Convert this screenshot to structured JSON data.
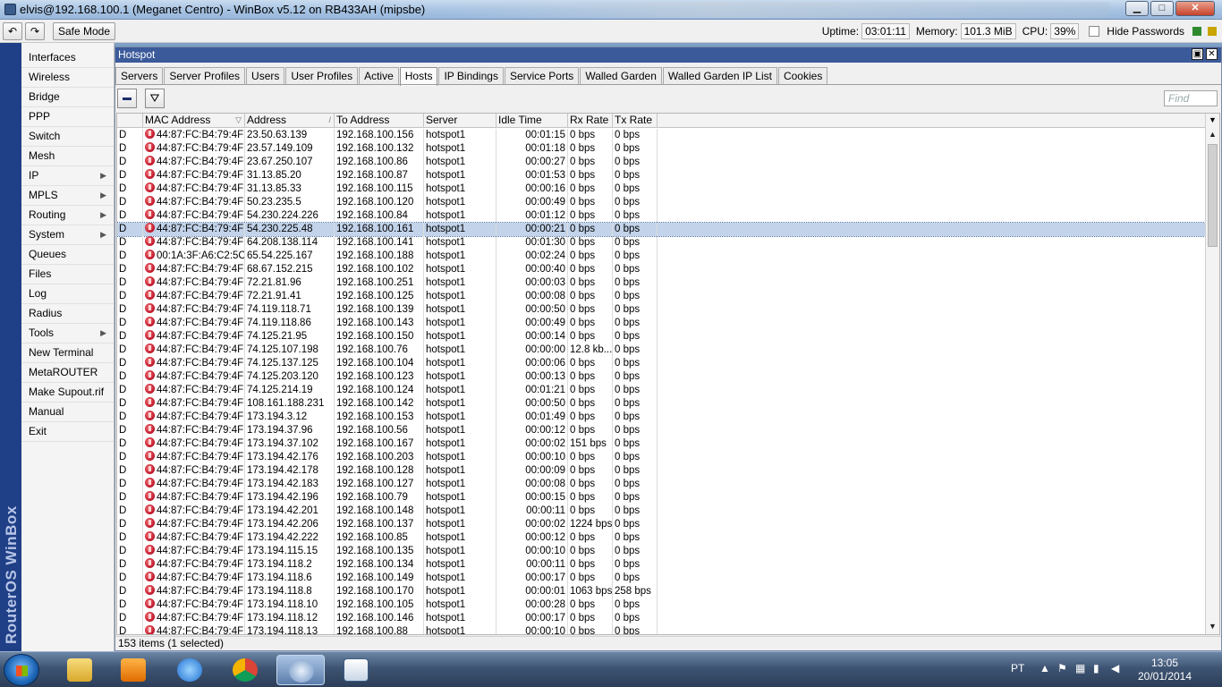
{
  "window": {
    "title": "elvis@192.168.100.1 (Meganet Centro) - WinBox v5.12 on RB433AH (mipsbe)",
    "buttons": {
      "minimize": "▁",
      "maximize": "□",
      "close": "✕"
    }
  },
  "toolbar": {
    "undo": "↶",
    "redo": "↷",
    "safe_mode": "Safe Mode",
    "uptime_label": "Uptime:",
    "uptime": "03:01:11",
    "memory_label": "Memory:",
    "memory": "101.3 MiB",
    "cpu_label": "CPU:",
    "cpu": "39%",
    "hide_passwords": "Hide Passwords"
  },
  "brand": "RouterOS WinBox",
  "menu": [
    {
      "label": "Interfaces",
      "arrow": ""
    },
    {
      "label": "Wireless",
      "arrow": ""
    },
    {
      "label": "Bridge",
      "arrow": ""
    },
    {
      "label": "PPP",
      "arrow": ""
    },
    {
      "label": "Switch",
      "arrow": ""
    },
    {
      "label": "Mesh",
      "arrow": ""
    },
    {
      "label": "IP",
      "arrow": "▶"
    },
    {
      "label": "MPLS",
      "arrow": "▶"
    },
    {
      "label": "Routing",
      "arrow": "▶"
    },
    {
      "label": "System",
      "arrow": "▶"
    },
    {
      "label": "Queues",
      "arrow": ""
    },
    {
      "label": "Files",
      "arrow": ""
    },
    {
      "label": "Log",
      "arrow": ""
    },
    {
      "label": "Radius",
      "arrow": ""
    },
    {
      "label": "Tools",
      "arrow": "▶"
    },
    {
      "label": "New Terminal",
      "arrow": ""
    },
    {
      "label": "MetaROUTER",
      "arrow": ""
    },
    {
      "label": "Make Supout.rif",
      "arrow": ""
    },
    {
      "label": "Manual",
      "arrow": ""
    },
    {
      "label": "Exit",
      "arrow": ""
    }
  ],
  "hotspot": {
    "title": "Hotspot",
    "tabs": [
      "Servers",
      "Server Profiles",
      "Users",
      "User Profiles",
      "Active",
      "Hosts",
      "IP Bindings",
      "Service Ports",
      "Walled Garden",
      "Walled Garden IP List",
      "Cookies"
    ],
    "active_tab": "Hosts",
    "filter_icon": "⛛",
    "find_placeholder": "Find",
    "columns": [
      {
        "label": "MAC Address",
        "sort": "▽"
      },
      {
        "label": "Address",
        "sort": "/"
      },
      {
        "label": "To Address",
        "sort": ""
      },
      {
        "label": "Server",
        "sort": ""
      },
      {
        "label": "Idle Time",
        "sort": ""
      },
      {
        "label": "Rx Rate",
        "sort": ""
      },
      {
        "label": "Tx Rate",
        "sort": ""
      }
    ],
    "scroll": {
      "col_menu": "▼",
      "up": "▲",
      "down": "▼"
    },
    "rows": [
      {
        "flag": "D",
        "mac": "44:87:FC:B4:79:4F",
        "address": "23.50.63.139",
        "to": "192.168.100.156",
        "server": "hotspot1",
        "idle": "00:01:15",
        "rx": "0 bps",
        "tx": "0 bps"
      },
      {
        "flag": "D",
        "mac": "44:87:FC:B4:79:4F",
        "address": "23.57.149.109",
        "to": "192.168.100.132",
        "server": "hotspot1",
        "idle": "00:01:18",
        "rx": "0 bps",
        "tx": "0 bps"
      },
      {
        "flag": "D",
        "mac": "44:87:FC:B4:79:4F",
        "address": "23.67.250.107",
        "to": "192.168.100.86",
        "server": "hotspot1",
        "idle": "00:00:27",
        "rx": "0 bps",
        "tx": "0 bps"
      },
      {
        "flag": "D",
        "mac": "44:87:FC:B4:79:4F",
        "address": "31.13.85.20",
        "to": "192.168.100.87",
        "server": "hotspot1",
        "idle": "00:01:53",
        "rx": "0 bps",
        "tx": "0 bps"
      },
      {
        "flag": "D",
        "mac": "44:87:FC:B4:79:4F",
        "address": "31.13.85.33",
        "to": "192.168.100.115",
        "server": "hotspot1",
        "idle": "00:00:16",
        "rx": "0 bps",
        "tx": "0 bps"
      },
      {
        "flag": "D",
        "mac": "44:87:FC:B4:79:4F",
        "address": "50.23.235.5",
        "to": "192.168.100.120",
        "server": "hotspot1",
        "idle": "00:00:49",
        "rx": "0 bps",
        "tx": "0 bps"
      },
      {
        "flag": "D",
        "mac": "44:87:FC:B4:79:4F",
        "address": "54.230.224.226",
        "to": "192.168.100.84",
        "server": "hotspot1",
        "idle": "00:01:12",
        "rx": "0 bps",
        "tx": "0 bps"
      },
      {
        "flag": "D",
        "mac": "44:87:FC:B4:79:4F",
        "address": "54.230.225.48",
        "to": "192.168.100.161",
        "server": "hotspot1",
        "idle": "00:00:21",
        "rx": "0 bps",
        "tx": "0 bps",
        "selected": true
      },
      {
        "flag": "D",
        "mac": "44:87:FC:B4:79:4F",
        "address": "64.208.138.114",
        "to": "192.168.100.141",
        "server": "hotspot1",
        "idle": "00:01:30",
        "rx": "0 bps",
        "tx": "0 bps"
      },
      {
        "flag": "D",
        "mac": "00:1A:3F:A6:C2:5C",
        "address": "65.54.225.167",
        "to": "192.168.100.188",
        "server": "hotspot1",
        "idle": "00:02:24",
        "rx": "0 bps",
        "tx": "0 bps"
      },
      {
        "flag": "D",
        "mac": "44:87:FC:B4:79:4F",
        "address": "68.67.152.215",
        "to": "192.168.100.102",
        "server": "hotspot1",
        "idle": "00:00:40",
        "rx": "0 bps",
        "tx": "0 bps"
      },
      {
        "flag": "D",
        "mac": "44:87:FC:B4:79:4F",
        "address": "72.21.81.96",
        "to": "192.168.100.251",
        "server": "hotspot1",
        "idle": "00:00:03",
        "rx": "0 bps",
        "tx": "0 bps"
      },
      {
        "flag": "D",
        "mac": "44:87:FC:B4:79:4F",
        "address": "72.21.91.41",
        "to": "192.168.100.125",
        "server": "hotspot1",
        "idle": "00:00:08",
        "rx": "0 bps",
        "tx": "0 bps"
      },
      {
        "flag": "D",
        "mac": "44:87:FC:B4:79:4F",
        "address": "74.119.118.71",
        "to": "192.168.100.139",
        "server": "hotspot1",
        "idle": "00:00:50",
        "rx": "0 bps",
        "tx": "0 bps"
      },
      {
        "flag": "D",
        "mac": "44:87:FC:B4:79:4F",
        "address": "74.119.118.86",
        "to": "192.168.100.143",
        "server": "hotspot1",
        "idle": "00:00:49",
        "rx": "0 bps",
        "tx": "0 bps"
      },
      {
        "flag": "D",
        "mac": "44:87:FC:B4:79:4F",
        "address": "74.125.21.95",
        "to": "192.168.100.150",
        "server": "hotspot1",
        "idle": "00:00:14",
        "rx": "0 bps",
        "tx": "0 bps"
      },
      {
        "flag": "D",
        "mac": "44:87:FC:B4:79:4F",
        "address": "74.125.107.198",
        "to": "192.168.100.76",
        "server": "hotspot1",
        "idle": "00:00:00",
        "rx": "12.8 kb...",
        "tx": "0 bps"
      },
      {
        "flag": "D",
        "mac": "44:87:FC:B4:79:4F",
        "address": "74.125.137.125",
        "to": "192.168.100.104",
        "server": "hotspot1",
        "idle": "00:00:06",
        "rx": "0 bps",
        "tx": "0 bps"
      },
      {
        "flag": "D",
        "mac": "44:87:FC:B4:79:4F",
        "address": "74.125.203.120",
        "to": "192.168.100.123",
        "server": "hotspot1",
        "idle": "00:00:13",
        "rx": "0 bps",
        "tx": "0 bps"
      },
      {
        "flag": "D",
        "mac": "44:87:FC:B4:79:4F",
        "address": "74.125.214.19",
        "to": "192.168.100.124",
        "server": "hotspot1",
        "idle": "00:01:21",
        "rx": "0 bps",
        "tx": "0 bps"
      },
      {
        "flag": "D",
        "mac": "44:87:FC:B4:79:4F",
        "address": "108.161.188.231",
        "to": "192.168.100.142",
        "server": "hotspot1",
        "idle": "00:00:50",
        "rx": "0 bps",
        "tx": "0 bps"
      },
      {
        "flag": "D",
        "mac": "44:87:FC:B4:79:4F",
        "address": "173.194.3.12",
        "to": "192.168.100.153",
        "server": "hotspot1",
        "idle": "00:01:49",
        "rx": "0 bps",
        "tx": "0 bps"
      },
      {
        "flag": "D",
        "mac": "44:87:FC:B4:79:4F",
        "address": "173.194.37.96",
        "to": "192.168.100.56",
        "server": "hotspot1",
        "idle": "00:00:12",
        "rx": "0 bps",
        "tx": "0 bps"
      },
      {
        "flag": "D",
        "mac": "44:87:FC:B4:79:4F",
        "address": "173.194.37.102",
        "to": "192.168.100.167",
        "server": "hotspot1",
        "idle": "00:00:02",
        "rx": "151 bps",
        "tx": "0 bps"
      },
      {
        "flag": "D",
        "mac": "44:87:FC:B4:79:4F",
        "address": "173.194.42.176",
        "to": "192.168.100.203",
        "server": "hotspot1",
        "idle": "00:00:10",
        "rx": "0 bps",
        "tx": "0 bps"
      },
      {
        "flag": "D",
        "mac": "44:87:FC:B4:79:4F",
        "address": "173.194.42.178",
        "to": "192.168.100.128",
        "server": "hotspot1",
        "idle": "00:00:09",
        "rx": "0 bps",
        "tx": "0 bps"
      },
      {
        "flag": "D",
        "mac": "44:87:FC:B4:79:4F",
        "address": "173.194.42.183",
        "to": "192.168.100.127",
        "server": "hotspot1",
        "idle": "00:00:08",
        "rx": "0 bps",
        "tx": "0 bps"
      },
      {
        "flag": "D",
        "mac": "44:87:FC:B4:79:4F",
        "address": "173.194.42.196",
        "to": "192.168.100.79",
        "server": "hotspot1",
        "idle": "00:00:15",
        "rx": "0 bps",
        "tx": "0 bps"
      },
      {
        "flag": "D",
        "mac": "44:87:FC:B4:79:4F",
        "address": "173.194.42.201",
        "to": "192.168.100.148",
        "server": "hotspot1",
        "idle": "00:00:11",
        "rx": "0 bps",
        "tx": "0 bps"
      },
      {
        "flag": "D",
        "mac": "44:87:FC:B4:79:4F",
        "address": "173.194.42.206",
        "to": "192.168.100.137",
        "server": "hotspot1",
        "idle": "00:00:02",
        "rx": "1224 bps",
        "tx": "0 bps"
      },
      {
        "flag": "D",
        "mac": "44:87:FC:B4:79:4F",
        "address": "173.194.42.222",
        "to": "192.168.100.85",
        "server": "hotspot1",
        "idle": "00:00:12",
        "rx": "0 bps",
        "tx": "0 bps"
      },
      {
        "flag": "D",
        "mac": "44:87:FC:B4:79:4F",
        "address": "173.194.115.15",
        "to": "192.168.100.135",
        "server": "hotspot1",
        "idle": "00:00:10",
        "rx": "0 bps",
        "tx": "0 bps"
      },
      {
        "flag": "D",
        "mac": "44:87:FC:B4:79:4F",
        "address": "173.194.118.2",
        "to": "192.168.100.134",
        "server": "hotspot1",
        "idle": "00:00:11",
        "rx": "0 bps",
        "tx": "0 bps"
      },
      {
        "flag": "D",
        "mac": "44:87:FC:B4:79:4F",
        "address": "173.194.118.6",
        "to": "192.168.100.149",
        "server": "hotspot1",
        "idle": "00:00:17",
        "rx": "0 bps",
        "tx": "0 bps"
      },
      {
        "flag": "D",
        "mac": "44:87:FC:B4:79:4F",
        "address": "173.194.118.8",
        "to": "192.168.100.170",
        "server": "hotspot1",
        "idle": "00:00:01",
        "rx": "1063 bps",
        "tx": "258 bps"
      },
      {
        "flag": "D",
        "mac": "44:87:FC:B4:79:4F",
        "address": "173.194.118.10",
        "to": "192.168.100.105",
        "server": "hotspot1",
        "idle": "00:00:28",
        "rx": "0 bps",
        "tx": "0 bps"
      },
      {
        "flag": "D",
        "mac": "44:87:FC:B4:79:4F",
        "address": "173.194.118.12",
        "to": "192.168.100.146",
        "server": "hotspot1",
        "idle": "00:00:17",
        "rx": "0 bps",
        "tx": "0 bps"
      },
      {
        "flag": "D",
        "mac": "44:87:FC:B4:79:4F",
        "address": "173.194.118.13",
        "to": "192.168.100.88",
        "server": "hotspot1",
        "idle": "00:00:10",
        "rx": "0 bps",
        "tx": "0 bps"
      }
    ],
    "status": "153 items (1 selected)"
  },
  "taskbar": {
    "apps": [
      "explorer",
      "media-player",
      "internet-explorer",
      "chrome",
      "winbox",
      "other-app"
    ],
    "active_app": "winbox",
    "lang": "PT",
    "time": "13:05",
    "date": "20/01/2014"
  }
}
